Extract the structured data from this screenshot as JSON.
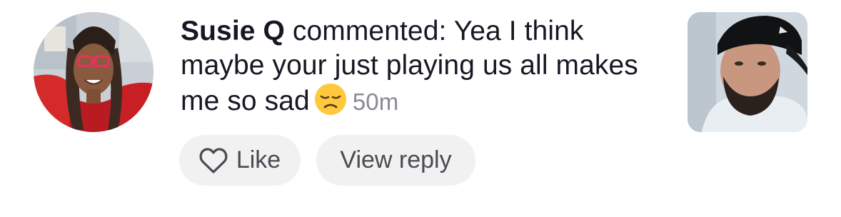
{
  "comment": {
    "username": "Susie Q",
    "action": " commented: ",
    "text": "Yea I think maybe your just playing us all makes me so sad",
    "emoji": "disappointed-face",
    "time": "50m"
  },
  "actions": {
    "like_label": "Like",
    "reply_label": "View reply"
  },
  "colors": {
    "text": "#161823",
    "muted": "#8a8b91",
    "button_bg": "#f1f1f2",
    "button_text": "#4a4b52"
  },
  "icons": {
    "like": "heart-outline-icon",
    "emoji": "disappointed-face-icon"
  }
}
